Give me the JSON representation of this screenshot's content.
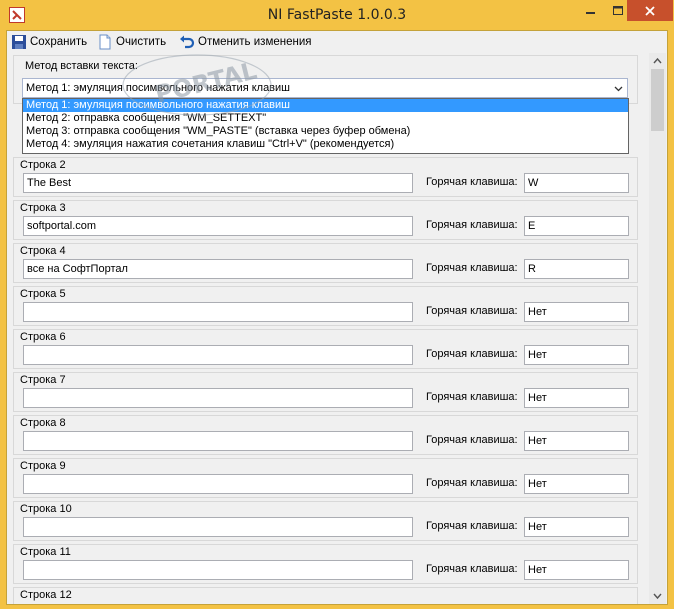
{
  "window": {
    "title": "NI FastPaste 1.0.0.3"
  },
  "toolbar": {
    "save_label": "Сохранить",
    "clear_label": "Очистить",
    "undo_label": "Отменить изменения"
  },
  "method": {
    "label": "Метод вставки текста:",
    "selected": "Метод 1: эмуляция посимвольного нажатия клавиш",
    "options": [
      "Метод 1: эмуляция посимвольного нажатия клавиш",
      "Метод 2: отправка сообщения \"WM_SETTEXT\"",
      "Метод 3: отправка сообщения \"WM_PASTE\" (вставка через буфер обмена)",
      "Метод 4: эмуляция нажатия сочетания клавиш \"Ctrl+V\" (рекомендуется)"
    ]
  },
  "rows": [
    {
      "label": "Строка 2",
      "text": "The Best",
      "hotkey_label": "Горячая клавиша:",
      "hotkey": "W"
    },
    {
      "label": "Строка 3",
      "text": "softportal.com",
      "hotkey_label": "Горячая клавиша:",
      "hotkey": "E"
    },
    {
      "label": "Строка 4",
      "text": "все на СофтПортал",
      "hotkey_label": "Горячая клавиша:",
      "hotkey": "R"
    },
    {
      "label": "Строка 5",
      "text": "",
      "hotkey_label": "Горячая клавиша:",
      "hotkey": "Нет"
    },
    {
      "label": "Строка 6",
      "text": "",
      "hotkey_label": "Горячая клавиша:",
      "hotkey": "Нет"
    },
    {
      "label": "Строка 7",
      "text": "",
      "hotkey_label": "Горячая клавиша:",
      "hotkey": "Нет"
    },
    {
      "label": "Строка 8",
      "text": "",
      "hotkey_label": "Горячая клавиша:",
      "hotkey": "Нет"
    },
    {
      "label": "Строка 9",
      "text": "",
      "hotkey_label": "Горячая клавиша:",
      "hotkey": "Нет"
    },
    {
      "label": "Строка 10",
      "text": "",
      "hotkey_label": "Горячая клавиша:",
      "hotkey": "Нет"
    },
    {
      "label": "Строка 11",
      "text": "",
      "hotkey_label": "Горячая клавиша:",
      "hotkey": "Нет"
    },
    {
      "label": "Строка 12",
      "text": "",
      "hotkey_label": "",
      "hotkey": ""
    }
  ],
  "watermark": {
    "text": "PORTAL"
  },
  "colors": {
    "title_bar": "#f3c244",
    "close_button": "#c7502c",
    "selection": "#3399ff"
  }
}
